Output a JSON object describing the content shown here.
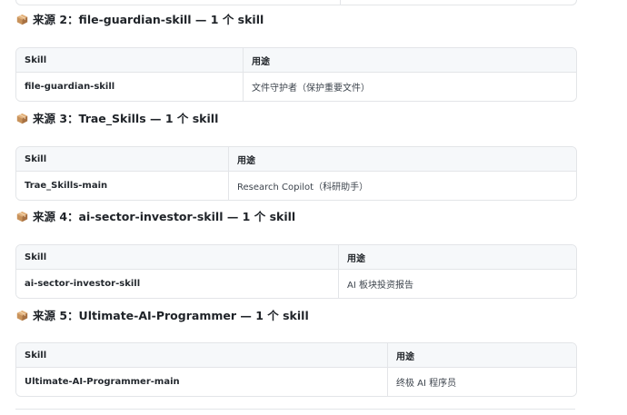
{
  "colors": {
    "box_icon": "#c8925a",
    "border": "#e3e5e8",
    "header_bg": "#f6f8fa"
  },
  "sections": [
    {
      "heading": "来源 2：file-guardian-skill — 1 个 skill",
      "icon": "package-box-icon",
      "table": {
        "headers": [
          "Skill",
          "用途"
        ],
        "rows": [
          [
            "file-guardian-skill",
            "文件守护者（保护重要文件）"
          ]
        ]
      }
    },
    {
      "heading": "来源 3：Trae_Skills — 1 个 skill",
      "icon": "package-box-icon",
      "table": {
        "headers": [
          "Skill",
          "用途"
        ],
        "rows": [
          [
            "Trae_Skills-main",
            "Research Copilot（科研助手）"
          ]
        ]
      }
    },
    {
      "heading": "来源 4：ai-sector-investor-skill — 1 个 skill",
      "icon": "package-box-icon",
      "table": {
        "headers": [
          "Skill",
          "用途"
        ],
        "rows": [
          [
            "ai-sector-investor-skill",
            "AI 板块投资报告"
          ]
        ]
      }
    },
    {
      "heading": "来源 5：Ultimate-AI-Programmer — 1 个 skill",
      "icon": "package-box-icon",
      "table": {
        "headers": [
          "Skill",
          "用途"
        ],
        "rows": [
          [
            "Ultimate-AI-Programmer-main",
            "终极 AI 程序员"
          ]
        ]
      }
    }
  ]
}
